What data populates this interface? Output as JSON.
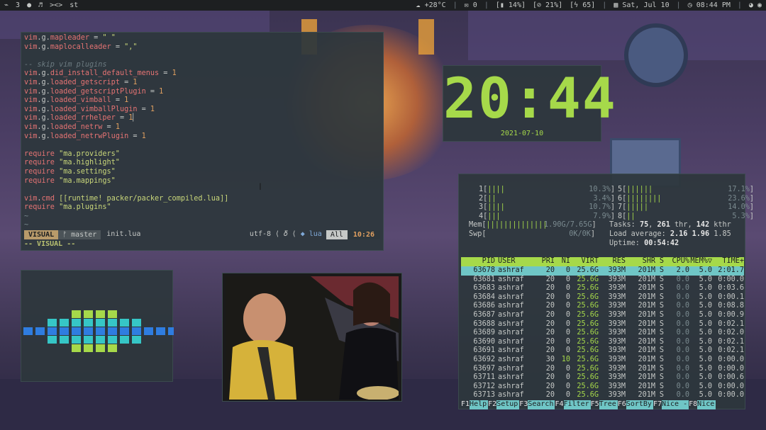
{
  "topbar": {
    "workspace": "3",
    "chat_icon": "chat-bubble-icon",
    "music_icon": "music-note-icon",
    "code_glyph": "><>",
    "app": "st",
    "weather": "+28°C",
    "mail_count": "0",
    "brightness": "[▮ 14%]",
    "volume": "[⊘ 21%]",
    "battery": "[ϟ 65]",
    "date": "Sat, Jul 10",
    "time": "08:44 PM"
  },
  "nvim": {
    "lines": [
      [
        {
          "t": "vim",
          "c": "k"
        },
        {
          "t": ".g.",
          "c": "p"
        },
        {
          "t": "mapleader",
          "c": "k"
        },
        {
          "t": " = ",
          "c": "p"
        },
        {
          "t": "\" \"",
          "c": "s"
        }
      ],
      [
        {
          "t": "vim",
          "c": "k"
        },
        {
          "t": ".g.",
          "c": "p"
        },
        {
          "t": "maplocalleader",
          "c": "k"
        },
        {
          "t": " = ",
          "c": "p"
        },
        {
          "t": "\",\"",
          "c": "s"
        }
      ],
      [
        {
          "t": "",
          "c": "p"
        }
      ],
      [
        {
          "t": "-- skip vim plugins",
          "c": "c"
        }
      ],
      [
        {
          "t": "vim",
          "c": "k"
        },
        {
          "t": ".g.",
          "c": "p"
        },
        {
          "t": "did_install_default_menus",
          "c": "k"
        },
        {
          "t": " = ",
          "c": "p"
        },
        {
          "t": "1",
          "c": "n"
        }
      ],
      [
        {
          "t": "vim",
          "c": "k"
        },
        {
          "t": ".g.",
          "c": "p"
        },
        {
          "t": "loaded_getscript",
          "c": "k"
        },
        {
          "t": " = ",
          "c": "p"
        },
        {
          "t": "1",
          "c": "n"
        }
      ],
      [
        {
          "t": "vim",
          "c": "k"
        },
        {
          "t": ".g.",
          "c": "p"
        },
        {
          "t": "loaded_getscriptPlugin",
          "c": "k"
        },
        {
          "t": " = ",
          "c": "p"
        },
        {
          "t": "1",
          "c": "n"
        }
      ],
      [
        {
          "t": "vim",
          "c": "k"
        },
        {
          "t": ".g.",
          "c": "p"
        },
        {
          "t": "loaded_vimball",
          "c": "k"
        },
        {
          "t": " = ",
          "c": "p"
        },
        {
          "t": "1",
          "c": "n"
        }
      ],
      [
        {
          "t": "vim",
          "c": "k"
        },
        {
          "t": ".g.",
          "c": "p"
        },
        {
          "t": "loaded_vimballPlugin",
          "c": "k"
        },
        {
          "t": " = ",
          "c": "p"
        },
        {
          "t": "1",
          "c": "n"
        }
      ],
      [
        {
          "t": "vim",
          "c": "k"
        },
        {
          "t": ".g.",
          "c": "p"
        },
        {
          "t": "loaded_rrhelper",
          "c": "k"
        },
        {
          "t": " = ",
          "c": "p"
        },
        {
          "t": "1",
          "c": "n"
        },
        {
          "t": "▏",
          "c": "p"
        }
      ],
      [
        {
          "t": "vim",
          "c": "k"
        },
        {
          "t": ".g.",
          "c": "p"
        },
        {
          "t": "loaded_netrw",
          "c": "k"
        },
        {
          "t": " = ",
          "c": "p"
        },
        {
          "t": "1",
          "c": "n"
        }
      ],
      [
        {
          "t": "vim",
          "c": "k"
        },
        {
          "t": ".g.",
          "c": "p"
        },
        {
          "t": "loaded_netrwPlugin",
          "c": "k"
        },
        {
          "t": " = ",
          "c": "p"
        },
        {
          "t": "1",
          "c": "n"
        }
      ],
      [
        {
          "t": "",
          "c": "p"
        }
      ],
      [
        {
          "t": "require",
          "c": "k"
        },
        {
          "t": " ",
          "c": "p"
        },
        {
          "t": "\"ma.providers\"",
          "c": "s"
        }
      ],
      [
        {
          "t": "require",
          "c": "k"
        },
        {
          "t": " ",
          "c": "p"
        },
        {
          "t": "\"ma.highlight\"",
          "c": "s"
        }
      ],
      [
        {
          "t": "require",
          "c": "k"
        },
        {
          "t": " ",
          "c": "p"
        },
        {
          "t": "\"ma.settings\"",
          "c": "s"
        }
      ],
      [
        {
          "t": "require",
          "c": "k"
        },
        {
          "t": " ",
          "c": "p"
        },
        {
          "t": "\"ma.mappings\"",
          "c": "s"
        }
      ],
      [
        {
          "t": "",
          "c": "p"
        }
      ],
      [
        {
          "t": "vim",
          "c": "k"
        },
        {
          "t": ".",
          "c": "p"
        },
        {
          "t": "cmd",
          "c": "k"
        },
        {
          "t": " ",
          "c": "p"
        },
        {
          "t": "[[runtime! packer/packer_compiled.lua]]",
          "c": "s"
        }
      ],
      [
        {
          "t": "require",
          "c": "k"
        },
        {
          "t": " ",
          "c": "p"
        },
        {
          "t": "\"ma.plugins\"",
          "c": "s"
        }
      ],
      [
        {
          "t": "~",
          "c": "t"
        }
      ],
      [
        {
          "t": "~",
          "c": "t"
        }
      ]
    ],
    "mode": "VISUAL",
    "branch": "ᚠ master",
    "file": "init.lua",
    "encoding": "utf-8  ⟨ 𝛿 ⟨",
    "filetype": "◆ lua",
    "position": "All",
    "clock": "10:26",
    "modeline": "-- VISUAL --"
  },
  "clock": {
    "time": "20:44",
    "date": "2021-07-10"
  },
  "visualizer": {
    "levels": [
      1,
      1,
      3,
      3,
      5,
      5,
      5,
      5,
      3,
      3,
      1,
      1,
      1,
      1
    ],
    "colors": [
      "#2f7de0",
      "#36c6c6",
      "#a6d94a"
    ]
  },
  "htop": {
    "cpus": [
      {
        "id": "1",
        "bar": "||||",
        "pct": "10.3%"
      },
      {
        "id": "2",
        "bar": "||",
        "pct": "3.4%"
      },
      {
        "id": "3",
        "bar": "||||",
        "pct": "10.7%"
      },
      {
        "id": "4",
        "bar": "|||",
        "pct": "7.9%"
      },
      {
        "id": "5",
        "bar": "||||||",
        "pct": "17.1%"
      },
      {
        "id": "6",
        "bar": "||||||||",
        "pct": "23.6%"
      },
      {
        "id": "7",
        "bar": "|||||",
        "pct": "14.0%"
      },
      {
        "id": "8",
        "bar": "||",
        "pct": "5.3%"
      }
    ],
    "mem": {
      "label": "Mem",
      "bar": "||||||||||||||",
      "val": "1.90G/7.65G"
    },
    "swp": {
      "label": "Swp",
      "bar": "",
      "val": "0K/0K"
    },
    "tasks": {
      "label": "Tasks: ",
      "n1": "75",
      "sep1": ", ",
      "n2": "261",
      "sep2": " thr, ",
      "n3": "142",
      "rest": " kthr"
    },
    "load": {
      "label": "Load average: ",
      "a": "2.16",
      "b": "1.96",
      "c": "1.85"
    },
    "uptime": {
      "label": "Uptime: ",
      "val": "00:54:42"
    },
    "columns": [
      "PID",
      "USER",
      "PRI",
      "NI",
      "VIRT",
      "RES",
      "SHR",
      "S",
      "CPU%",
      "MEM%▽",
      "TIME+"
    ],
    "rows": [
      [
        "63678",
        "ashraf",
        "20",
        "0",
        "25.6G",
        "393M",
        "201M",
        "S",
        "2.0",
        "5.0",
        "2:01.7"
      ],
      [
        "63681",
        "ashraf",
        "20",
        "0",
        "25.6G",
        "393M",
        "201M",
        "S",
        "0.0",
        "5.0",
        "0:00.0"
      ],
      [
        "63683",
        "ashraf",
        "20",
        "0",
        "25.6G",
        "393M",
        "201M",
        "S",
        "0.0",
        "5.0",
        "0:03.6"
      ],
      [
        "63684",
        "ashraf",
        "20",
        "0",
        "25.6G",
        "393M",
        "201M",
        "S",
        "0.0",
        "5.0",
        "0:00.1"
      ],
      [
        "63686",
        "ashraf",
        "20",
        "0",
        "25.6G",
        "393M",
        "201M",
        "S",
        "0.0",
        "5.0",
        "0:08.8"
      ],
      [
        "63687",
        "ashraf",
        "20",
        "0",
        "25.6G",
        "393M",
        "201M",
        "S",
        "0.0",
        "5.0",
        "0:00.9"
      ],
      [
        "63688",
        "ashraf",
        "20",
        "0",
        "25.6G",
        "393M",
        "201M",
        "S",
        "0.0",
        "5.0",
        "0:02.1"
      ],
      [
        "63689",
        "ashraf",
        "20",
        "0",
        "25.6G",
        "393M",
        "201M",
        "S",
        "0.0",
        "5.0",
        "0:02.0"
      ],
      [
        "63690",
        "ashraf",
        "20",
        "0",
        "25.6G",
        "393M",
        "201M",
        "S",
        "0.0",
        "5.0",
        "0:02.1"
      ],
      [
        "63691",
        "ashraf",
        "20",
        "0",
        "25.6G",
        "393M",
        "201M",
        "S",
        "0.0",
        "5.0",
        "0:02.1"
      ],
      [
        "63692",
        "ashraf",
        "30",
        "10",
        "25.6G",
        "393M",
        "201M",
        "S",
        "0.0",
        "5.0",
        "0:00.0"
      ],
      [
        "63697",
        "ashraf",
        "20",
        "0",
        "25.6G",
        "393M",
        "201M",
        "S",
        "0.0",
        "5.0",
        "0:00.0"
      ],
      [
        "63711",
        "ashraf",
        "20",
        "0",
        "25.6G",
        "393M",
        "201M",
        "S",
        "0.0",
        "5.0",
        "0:00.6"
      ],
      [
        "63712",
        "ashraf",
        "20",
        "0",
        "25.6G",
        "393M",
        "201M",
        "S",
        "0.0",
        "5.0",
        "0:00.0"
      ],
      [
        "63713",
        "ashraf",
        "20",
        "0",
        "25.6G",
        "393M",
        "201M",
        "S",
        "0.0",
        "5.0",
        "0:00.0"
      ]
    ],
    "fkeys": [
      [
        "F1",
        "Help"
      ],
      [
        "F2",
        "Setup"
      ],
      [
        "F3",
        "Search"
      ],
      [
        "F4",
        "Filter"
      ],
      [
        "F5",
        "Tree"
      ],
      [
        "F6",
        "SortBy"
      ],
      [
        "F7",
        "Nice -"
      ],
      [
        "F8",
        "Nice"
      ]
    ]
  }
}
